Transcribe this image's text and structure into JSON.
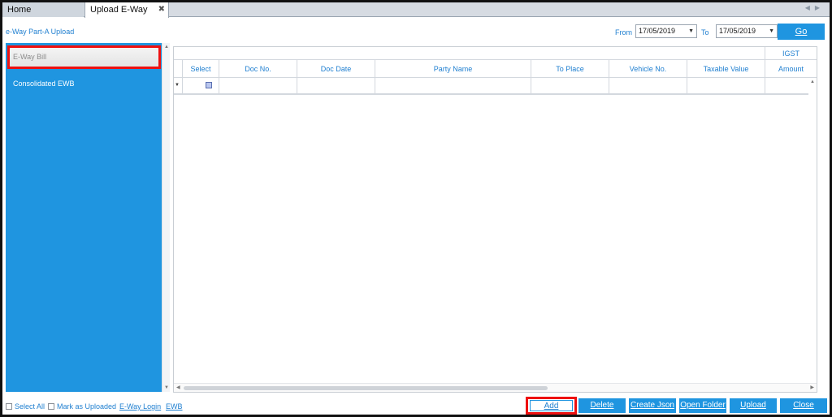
{
  "tabs": {
    "home": "Home",
    "upload": "Upload E-Way",
    "close_glyph": "✖"
  },
  "header": {
    "title": "e-Way Part-A Upload",
    "from_label": "From",
    "from_date": "17/05/2019",
    "to_label": "To",
    "to_date": "17/05/2019",
    "go_label": "Go"
  },
  "sidebar": {
    "items": [
      {
        "label": "E-Way Bill",
        "selected": true
      },
      {
        "label": "Consolidated EWB",
        "selected": false
      }
    ]
  },
  "grid": {
    "group_header": "IGST",
    "columns": [
      "Select",
      "Doc No.",
      "Doc Date",
      "Party Name",
      "To Place",
      "Vehicle No.",
      "Taxable Value",
      "Amount"
    ]
  },
  "footer": {
    "select_all": "Select All",
    "mark_uploaded": "Mark as Uploaded",
    "eway_login": "E-Way Login",
    "ewb": "EWB",
    "buttons": {
      "add": "Add",
      "delete": "Delete",
      "create_json": "Create Json",
      "open_folder": "Open Folder",
      "upload": "Upload",
      "close": "Close"
    }
  },
  "colors": {
    "accent": "#1f95e0",
    "highlight": "#e11111"
  }
}
